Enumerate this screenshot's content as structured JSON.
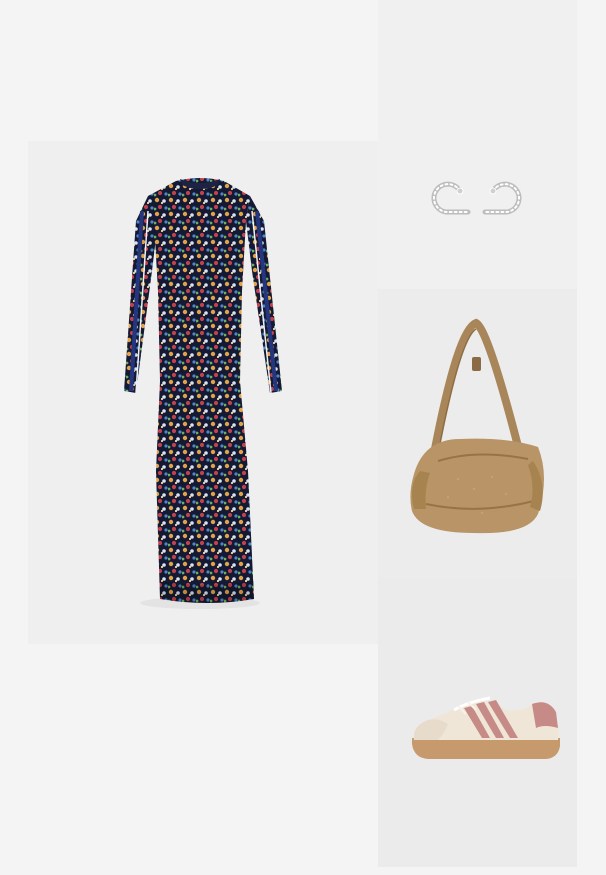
{
  "outfit": {
    "items": [
      {
        "product": "floral-print-long-sleeve-maxi-dress",
        "icon": "dress-image",
        "colors": [
          "#1c2f6b",
          "#d8a043",
          "#9a3a4a",
          "#e6d6b8"
        ]
      },
      {
        "product": "silver-crystal-swirl-earrings",
        "icon": "earrings-image",
        "colors": [
          "#d9d9d9",
          "#ffffff"
        ]
      },
      {
        "product": "tan-suede-slouch-shoulder-bag",
        "icon": "bag-image",
        "colors": [
          "#b38f60",
          "#a07c4f"
        ]
      },
      {
        "product": "cream-and-pink-gum-sole-sneakers",
        "icon": "sneaker-image",
        "colors": [
          "#efe6d8",
          "#c68b86",
          "#c69a6d"
        ]
      }
    ]
  }
}
